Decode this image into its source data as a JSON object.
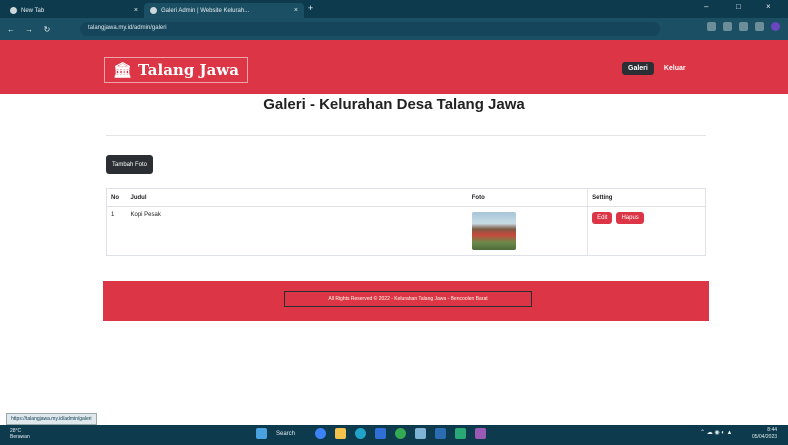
{
  "browser": {
    "tabs": [
      {
        "label": "New Tab"
      },
      {
        "label": "Galeri Admin | Website Kelurah..."
      }
    ],
    "url": "talangjawa.my.id/admin/galeri",
    "status_url": "https://talangjawa.my.id/admin/galeri"
  },
  "navbar": {
    "brand": "Talang Jawa",
    "links": [
      {
        "label": "Galeri"
      },
      {
        "label": "Keluar"
      }
    ]
  },
  "main": {
    "title": "Galeri - Kelurahan Desa Talang Jawa",
    "add_button": "Tambah Foto",
    "table": {
      "headers": [
        "No",
        "Judul",
        "Foto",
        "Setting"
      ],
      "rows": [
        {
          "no": "1",
          "judul": "Kopi Pesak",
          "edit": "Edit",
          "hapus": "Hapus"
        }
      ]
    }
  },
  "footer": {
    "text": "All Rights Reserved © 2022 - Kelurahan Talang Jawa - Bencoolen Barat"
  },
  "taskbar": {
    "weather_line1": "28°C",
    "weather_line2": "Berawan",
    "search": "Search",
    "time": "8:44",
    "date": "05/04/2023"
  },
  "colors": {
    "brand_red": "#dc3545",
    "dark_button": "#2b2f33",
    "chrome_dark": "#0d3b4d"
  }
}
